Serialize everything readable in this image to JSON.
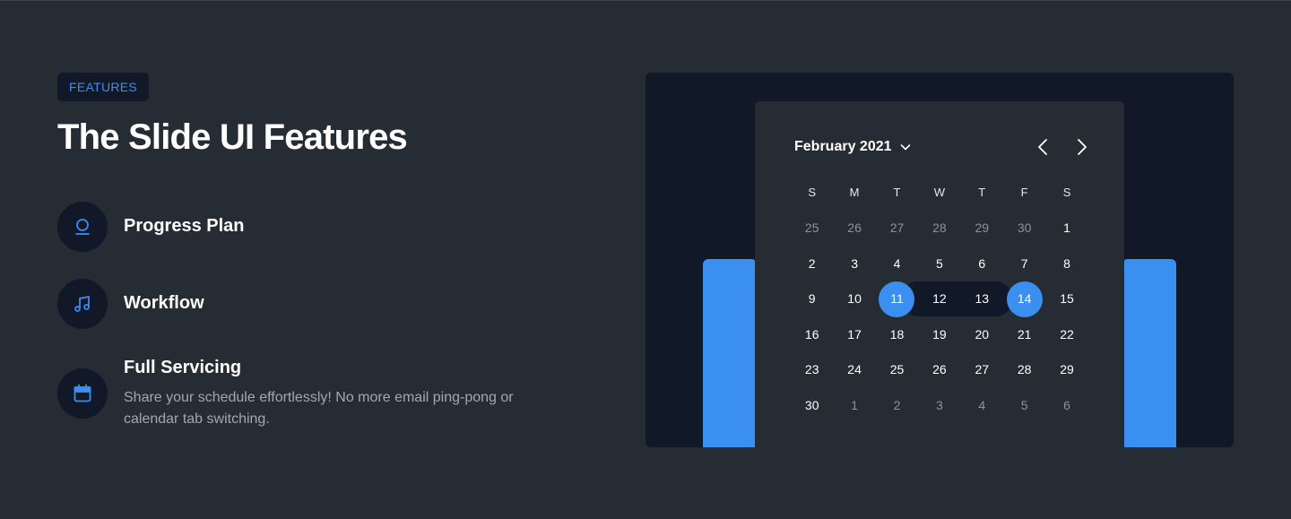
{
  "badge": "FEATURES",
  "title": "The Slide UI Features",
  "features": [
    {
      "title": "Progress Plan",
      "icon": "progress-icon"
    },
    {
      "title": "Workflow",
      "icon": "music-note-icon"
    },
    {
      "title": "Full Servicing",
      "icon": "calendar-icon",
      "description": "Share your schedule effortlessly! No more email ping-pong or calendar tab switching."
    }
  ],
  "calendar": {
    "month": "February 2021",
    "weekdays": [
      "S",
      "M",
      "T",
      "W",
      "T",
      "F",
      "S"
    ],
    "weeks": [
      [
        "25",
        "26",
        "27",
        "28",
        "29",
        "30",
        "1"
      ],
      [
        "2",
        "3",
        "4",
        "5",
        "6",
        "7",
        "8"
      ],
      [
        "9",
        "10",
        "11",
        "12",
        "13",
        "14",
        "15"
      ],
      [
        "16",
        "17",
        "18",
        "19",
        "20",
        "21",
        "22"
      ],
      [
        "23",
        "24",
        "25",
        "26",
        "27",
        "28",
        "29"
      ],
      [
        "30",
        "1",
        "2",
        "3",
        "4",
        "5",
        "6"
      ]
    ],
    "range_start": "11",
    "range_end": "14"
  },
  "colors": {
    "accent": "#3b8ff0",
    "background": "#262c33",
    "panel": "#111827"
  }
}
